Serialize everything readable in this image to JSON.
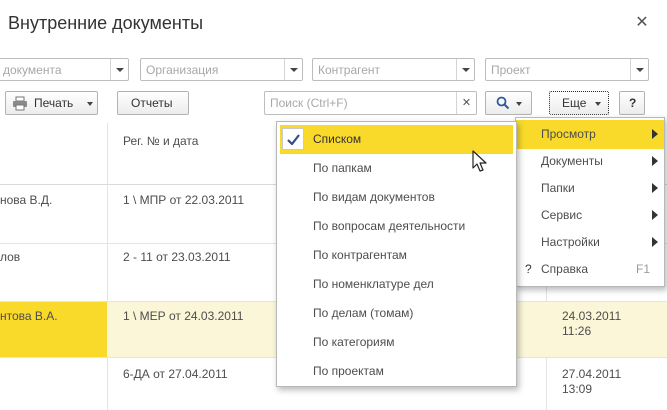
{
  "window": {
    "title": "Внутренние документы"
  },
  "filters": [
    {
      "placeholder": "документа"
    },
    {
      "placeholder": "Организация"
    },
    {
      "placeholder": "Контрагент"
    },
    {
      "placeholder": "Проект"
    }
  ],
  "toolbar": {
    "print_label": "Печать",
    "reports_label": "Отчеты",
    "search_placeholder": "Поиск (Ctrl+F)",
    "more_label": "Еще",
    "help_label": "?"
  },
  "table": {
    "header_reg": "Рег. № и дата",
    "rows": [
      {
        "author": "нова В.Д.",
        "reg": "1 \\ МПР от 22.03.2011",
        "date": "",
        "time": ""
      },
      {
        "author": "лов",
        "reg": "2 - 11 от 23.03.2011",
        "date": "",
        "time": ""
      },
      {
        "author": "нтова В.А.",
        "reg": "1 \\ МЕР от 24.03.2011",
        "date": "24.03.2011",
        "time": "11:26"
      },
      {
        "author": "",
        "reg": "6-ДА от 27.04.2011",
        "date": "27.04.2011",
        "time": "13:09"
      }
    ]
  },
  "more_menu": {
    "items": [
      {
        "label": "Просмотр"
      },
      {
        "label": "Документы"
      },
      {
        "label": "Папки"
      },
      {
        "label": "Сервис"
      },
      {
        "label": "Настройки"
      },
      {
        "label": "Справка",
        "shortcut": "F1",
        "icon": "?"
      }
    ]
  },
  "view_submenu": {
    "items": [
      {
        "label": "Списком"
      },
      {
        "label": "По папкам"
      },
      {
        "label": "По видам документов"
      },
      {
        "label": "По вопросам деятельности"
      },
      {
        "label": "По контрагентам"
      },
      {
        "label": "По номенклатуре дел"
      },
      {
        "label": "По делам (томам)"
      },
      {
        "label": "По категориям"
      },
      {
        "label": "По проектам"
      }
    ]
  },
  "colors": {
    "accent": "#f9da2b",
    "highlight_row": "#fbf6d8"
  }
}
